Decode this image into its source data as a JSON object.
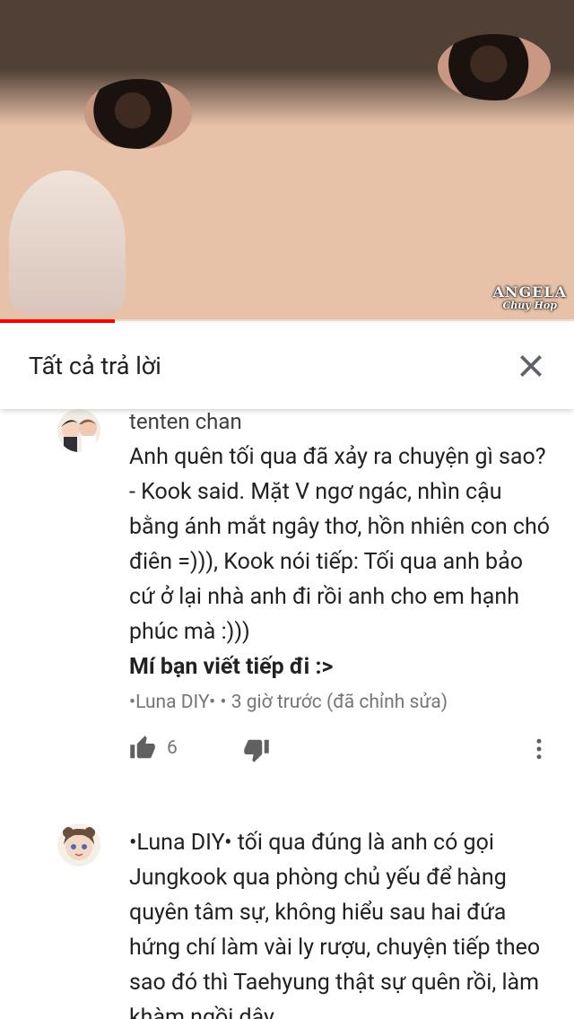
{
  "video": {
    "watermark_line1": "ANGELA",
    "watermark_line2": "Chuy Hop",
    "progress_fraction": 0.2
  },
  "panel": {
    "title": "Tất cả trả lời",
    "close_icon": "close-icon"
  },
  "comments": [
    {
      "author": "tenten chan",
      "text": "Anh quên tối qua đã xảy ra chuyện gì sao?- Kook said. Mặt V ngơ ngác, nhìn cậu bằng ánh mắt ngây thơ, hồn nhiên con chó điên =))), Kook nói tiếp: Tối qua anh bảo cứ ở lại nhà anh đi rồi anh cho em hạnh phúc mà :)))",
      "bold_text": "Mí bạn viết tiếp đi :>",
      "meta": "•Luna DIY• • 3 giờ trước (đã chỉnh sửa)",
      "likes": "6",
      "like_icon": "thumbs-up-icon",
      "dislike_icon": "thumbs-down-icon",
      "more_icon": "more-vert-icon"
    },
    {
      "author": "",
      "text": "•Luna DIY• tối qua đúng là anh có gọi Jungkook qua phòng chủ yếu để hàng quyên tâm sự, không hiểu sau hai đứa hứng chí làm vài ly rượu, chuyện tiếp theo sao đó thì Taehyung thật sự quên rồi, làm khàm ngồi dậy"
    }
  ],
  "colors": {
    "progress": "#ff0000",
    "meta_text": "#767676",
    "main_text": "#212121"
  }
}
